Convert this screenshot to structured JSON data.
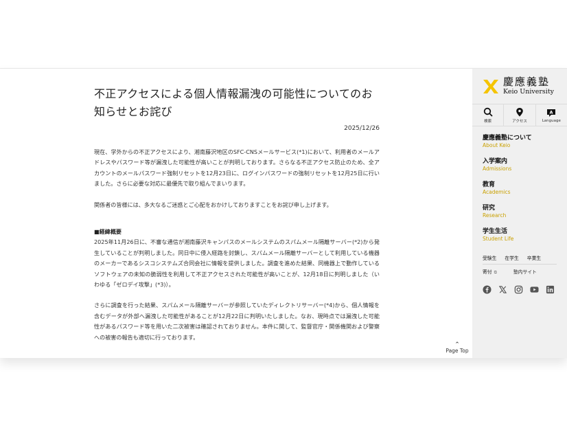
{
  "article": {
    "title": "不正アクセスによる個人情報漏洩の可能性についてのお知らせとお詫び",
    "date": "2025/12/26",
    "p1": "現在、学外からの不正アクセスにより、湘南藤沢地区のSFC-CNSメールサービス(*1)において、利用者のメールアドレスやパスワード等が漏洩した可能性が高いことが判明しております。さらなる不正アクセス防止のため、全アカウントのメールパスワード強制リセットを12月23日に、ログインパスワードの強制リセットを12月25日に行いました。さらに必要な対応に最優先で取り組んでまいります。",
    "p2": "関係者の皆様には、多大なるご迷惑とご心配をおかけしておりますことをお詫び申し上げます。",
    "heading": "■経緯概要",
    "p3": "2025年11月26日に、不審な通信が湘南藤沢キャンパスのメールシステムのスパムメール隔離サーバー(*2)から発生していることが判明しました。同日中に侵入経路を封鎖し、スパムメール隔離サーバーとして利用している機器のメーカーであるシスコシステムズ合同会社に情報を提供しました。調査を進めた結果、同機器上で動作しているソフトウェアの未知の脆弱性を利用して不正アクセスされた可能性が高いことが、12月18日に判明しました（いわゆる「ゼロデイ攻撃」(*3)）。",
    "p4": "さらに調査を行った結果、スパムメール隔離サーバーが参照していたディレクトリサーバー(*4)から、個人情報を含むデータが外部へ漏洩した可能性があることが12月22日に判明いたしました。なお、現時点では漏洩した可能性があるパスワード等を用いた二次被害は確認されておりません。本件に関して、監督官庁・関係機関および警察への被害の報告も適切に行っております。"
  },
  "page_top": "Page Top",
  "logo": {
    "jp": "慶應義塾",
    "en": "Keio University"
  },
  "tools": [
    {
      "label": "検索",
      "icon": "search-icon"
    },
    {
      "label": "アクセス",
      "icon": "map-pin-icon"
    },
    {
      "label": "Language",
      "icon": "language-icon"
    }
  ],
  "nav": [
    {
      "jp": "慶應義塾について",
      "en": "About Keio"
    },
    {
      "jp": "入学案内",
      "en": "Admissions"
    },
    {
      "jp": "教育",
      "en": "Academics"
    },
    {
      "jp": "研究",
      "en": "Research"
    },
    {
      "jp": "学生生活",
      "en": "Student Life"
    }
  ],
  "links": {
    "row1": [
      "受験生",
      "在学生",
      "卒業生"
    ],
    "row2": [
      "寄付",
      "塾内サイト"
    ]
  },
  "social": [
    "facebook-icon",
    "x-icon",
    "instagram-icon",
    "youtube-icon",
    "linkedin-icon"
  ],
  "colors": {
    "accent": "#f5c400",
    "accent_text": "#c9a000",
    "sidebar_bg": "#f0f0f0"
  }
}
